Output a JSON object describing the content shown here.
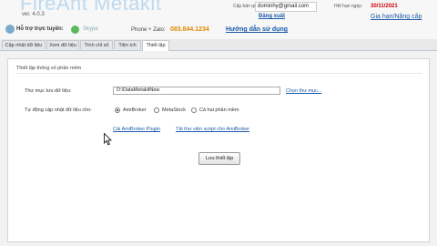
{
  "header": {
    "app_name": "FireAnt Metakit",
    "version": "ver. 4.0.3",
    "support_label": "Hỗ trợ trực tuyến:",
    "skype_label": "Skype",
    "phone_label": "Phone + Zalo:",
    "phone_number": "083.844.1234",
    "guide_link": "Hướng dẫn sử dụng",
    "license_label": "Cấp bản quyền cho:",
    "license_user": "dominhy@gmail.com",
    "logout_link": "Đăng xuất",
    "expiry_label": "Hết hạn ngày:",
    "expiry_date": "30/11/2021",
    "upgrade_link": "Gia hạn/Nâng cấp"
  },
  "tabs": [
    {
      "label": "Cập nhật dữ liệu"
    },
    {
      "label": "Xem dữ liệu"
    },
    {
      "label": "Tính chỉ số"
    },
    {
      "label": "Tiện ích"
    },
    {
      "label": "Thiết lập",
      "active": true
    }
  ],
  "settings": {
    "section_title": "Thiết lập thông số phần mềm",
    "folder_label": "Thư mục lưu dữ liệu:",
    "folder_value": "D:\\DataMetakitNew",
    "choose_folder_link": "Chọn thư mục...",
    "autoupdate_label": "Tự động cập nhật dữ liệu cho:",
    "options": [
      {
        "label": "AmiBroker",
        "selected": true
      },
      {
        "label": "MetaStock",
        "selected": false
      },
      {
        "label": "Cả hai phần mềm",
        "selected": false
      }
    ],
    "plugin_link": "Cài AmiBroker Plugin",
    "script_link": "Tải thư viện script cho AmiBroker",
    "save_button": "Lưu thiết lập"
  }
}
